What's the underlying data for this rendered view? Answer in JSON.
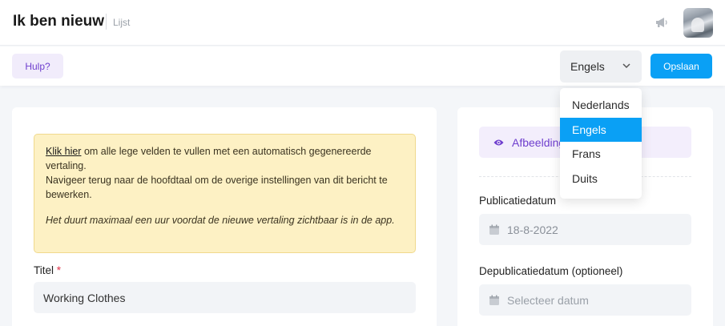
{
  "header": {
    "title": "Ik ben nieuw",
    "breadcrumb": "Lijst",
    "notification_icon": "megaphone-icon",
    "avatar_alt": "user-avatar"
  },
  "toolbar": {
    "help_label": "Hulp?",
    "language_selected": "Engels",
    "save_label": "Opslaan"
  },
  "language_dropdown": {
    "options": [
      "Nederlands",
      "Engels",
      "Frans",
      "Duits"
    ],
    "selected_index": 1
  },
  "notice": {
    "link_text": "Klik hier",
    "line1_rest": " om alle lege velden te vullen met een automatisch gegenereerde vertaling.",
    "line2": "Navigeer terug naar de hoofdtaal om de overige instellingen van dit bericht te bewerken.",
    "line3": "Het duurt maximaal een uur voordat de nieuwe vertaling zichtbaar is in de app."
  },
  "form": {
    "title_label": "Titel",
    "title_required_mark": "*",
    "title_value": "Working Clothes"
  },
  "sidebar": {
    "image_tab_label": "Afbeelding",
    "publish_label": "Publicatiedatum",
    "publish_value": "18-8-2022",
    "unpublish_label": "Depublicatiedatum (optioneel)",
    "unpublish_placeholder": "Selecteer datum"
  },
  "colors": {
    "primary": "#0aa0f5",
    "accent_purple": "#6f3fce",
    "notice_bg": "#fdf1c4"
  }
}
